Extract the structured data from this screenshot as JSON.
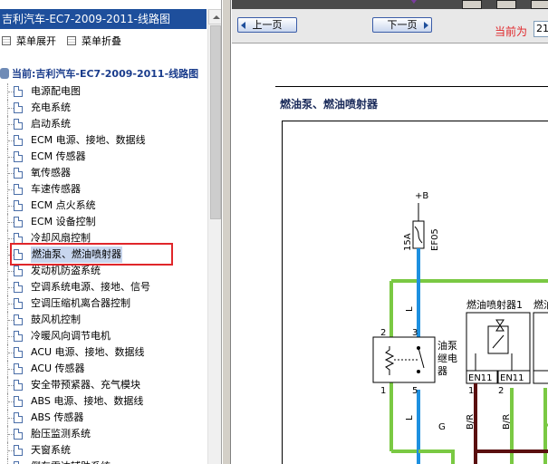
{
  "left_panel": {
    "title": "吉利汽车-EC7-2009-2011-线路图",
    "menu_expand": "菜单展开",
    "menu_collapse": "菜单折叠",
    "root": "当前:吉利汽车-EC7-2009-2011-线路图",
    "items": [
      {
        "label": "电源配电图"
      },
      {
        "label": "充电系统"
      },
      {
        "label": "启动系统"
      },
      {
        "label": "ECM 电源、接地、数据线"
      },
      {
        "label": "ECM 传感器"
      },
      {
        "label": "氧传感器"
      },
      {
        "label": "车速传感器"
      },
      {
        "label": "ECM 点火系统"
      },
      {
        "label": "ECM 设备控制"
      },
      {
        "label": "冷却风扇控制"
      },
      {
        "label": "燃油泵、燃油喷射器",
        "selected": true
      },
      {
        "label": "发动机防盗系统"
      },
      {
        "label": "空调系统电源、接地、信号"
      },
      {
        "label": "空调压缩机离合器控制"
      },
      {
        "label": "鼓风机控制"
      },
      {
        "label": "冷暖风向调节电机"
      },
      {
        "label": "ACU 电源、接地、数据线"
      },
      {
        "label": "ACU 传感器"
      },
      {
        "label": "安全带预紧器、充气模块"
      },
      {
        "label": "ABS 电源、接地、数据线"
      },
      {
        "label": "ABS 传感器"
      },
      {
        "label": "胎压监测系统"
      },
      {
        "label": "天窗系统"
      },
      {
        "label": "倒车雷达辅助系统"
      }
    ]
  },
  "nav": {
    "prev": "上一页",
    "next": "下一页",
    "current_label": "当前为",
    "page_value": "21"
  },
  "content": {
    "section_title": "燃油泵、燃油喷射器"
  },
  "schematic": {
    "plus_b": "+B",
    "fuse_rating": "15A",
    "fuse_id": "EF05",
    "relay_pin_2": "2",
    "relay_pin_3": "3",
    "relay_pin_1": "1",
    "relay_pin_5": "5",
    "relay_name": [
      "油泵",
      "继电",
      "器"
    ],
    "wire_L_1": "L",
    "wire_L_2": "L",
    "wire_G": "G",
    "wire_BR_1": "B/R",
    "wire_BR_2": "B/R",
    "injector_1": "燃油喷射器1",
    "injector_2": "燃油",
    "conn_1": "EN11",
    "conn_2": "EN11",
    "inj_pin_1": "1",
    "inj_pin_2": "2",
    "colors": {
      "wire_green": "#7ac943",
      "wire_blue": "#1e90e0",
      "wire_brown": "#5a1010",
      "accent": "#1e4f9c",
      "highlight": "#e0262a"
    }
  }
}
